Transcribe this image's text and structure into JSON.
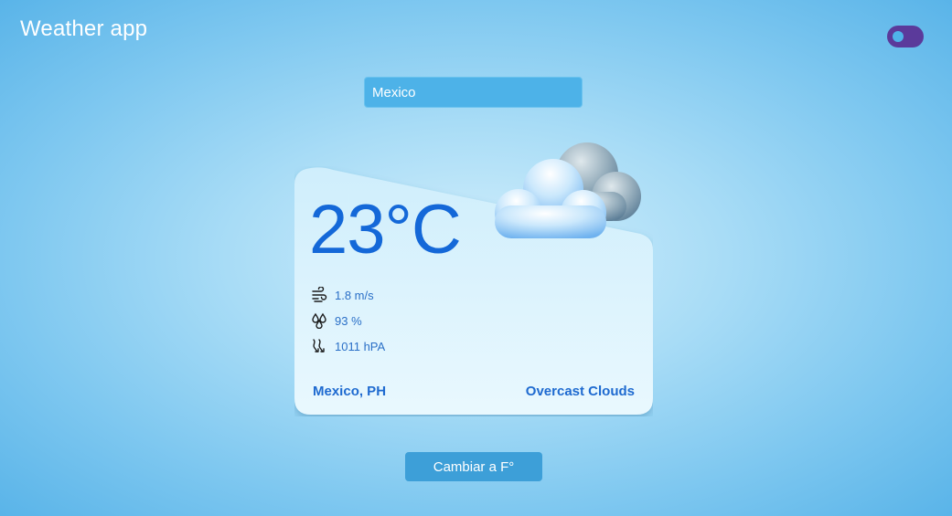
{
  "app": {
    "title": "Weather app"
  },
  "theme_toggle": {
    "state": "on",
    "track_color": "#5b3a9b",
    "knob_color": "#4fb3ea"
  },
  "search": {
    "value": "Mexico",
    "placeholder": ""
  },
  "weather": {
    "temperature": "23°C",
    "condition_icon": "overcast-clouds-icon",
    "stats": [
      {
        "icon": "wind-icon",
        "value": "1.8 m/s"
      },
      {
        "icon": "humidity-icon",
        "value": "93 %"
      },
      {
        "icon": "pressure-icon",
        "value": "1011 hPA"
      }
    ],
    "location": "Mexico, PH",
    "description": "Overcast Clouds"
  },
  "actions": {
    "toggle_unit_label": "Cambiar a F°"
  },
  "colors": {
    "accent_blue": "#1468d8",
    "button_blue": "#3d9fd8",
    "input_blue": "#4db2e8",
    "background": "#7fc8f0"
  }
}
